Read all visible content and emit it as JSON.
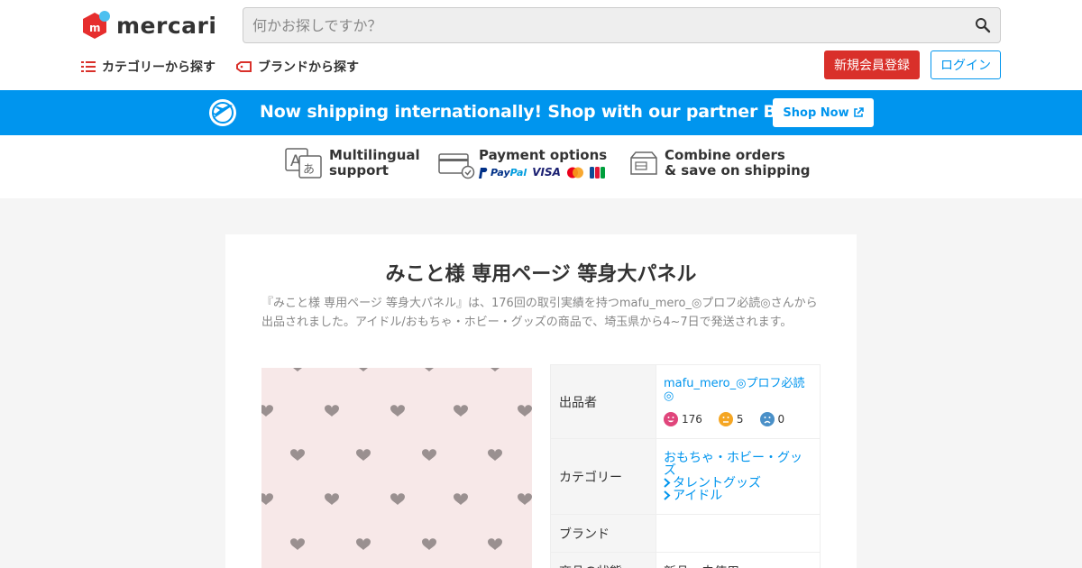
{
  "header": {
    "logo_text": "mercari",
    "search_placeholder": "何かお探しですか？",
    "nav_category": "カテゴリーから探す",
    "nav_brand": "ブランドから探す",
    "signup_label": "新規会員登録",
    "login_label": "ログイン"
  },
  "banner": {
    "text": "Now shipping internationally! Shop with our partner Buyee!",
    "button_label": "Shop Now"
  },
  "features": {
    "multilingual_line1": "Multilingual",
    "multilingual_line2": "support",
    "payment_title": "Payment options",
    "payment_logos": [
      "PayPal",
      "VISA",
      "Mastercard",
      "JCB"
    ],
    "paypal_a": "Pay",
    "paypal_b": "Pal",
    "visa": "VISA",
    "combine_line1": "Combine orders",
    "combine_line2": "& save on shipping"
  },
  "item": {
    "title": "みこと様 専用ページ 等身大パネル",
    "description": "『みこと様 専用ページ 等身大パネル』は、176回の取引実績を持つmafu_mero_◎プロフ必読◎さんから出品されました。アイドル/おもちゃ・ホビー・グッズの商品で、埼玉県から4~7日で発送されます。"
  },
  "details": {
    "seller_label": "出品者",
    "seller_name": "mafu_mero_◎プロフ必読◎",
    "rating_good": "176",
    "rating_normal": "5",
    "rating_bad": "0",
    "category_label": "カテゴリー",
    "category_main": "おもちゃ・ホビー・グッズ",
    "category_sub1": "タレントグッズ",
    "category_sub2": "アイドル",
    "brand_label": "ブランド",
    "brand_value": "",
    "condition_label": "商品の状態",
    "condition_value": "新品、未使用"
  },
  "colors": {
    "brand_red": "#d9302a",
    "accent_blue": "#0095ee",
    "photo_bg": "#f7e8e8",
    "heart": "#9a9090"
  }
}
